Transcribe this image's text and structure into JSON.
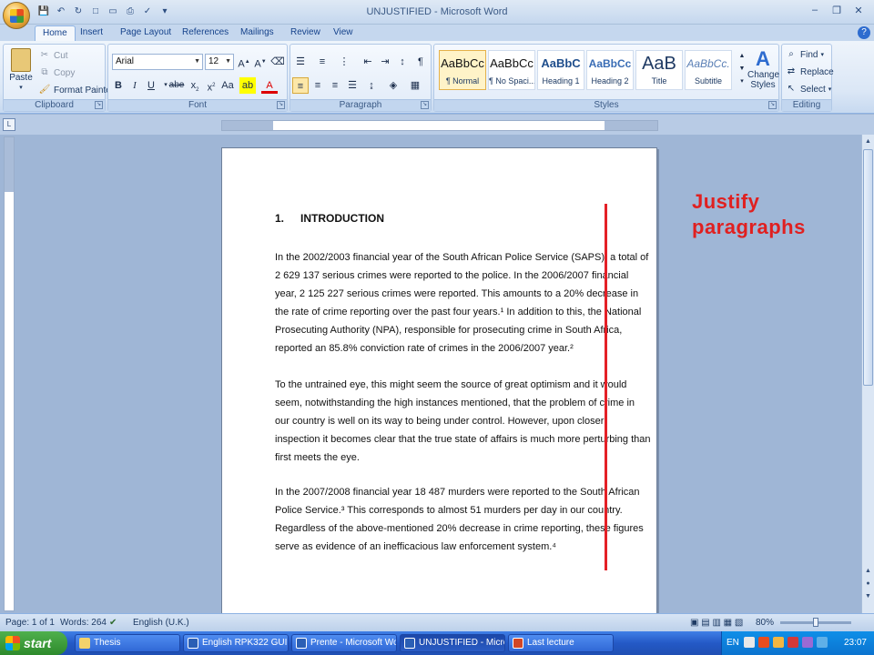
{
  "window": {
    "title": "UNJUSTIFIED - Microsoft Word"
  },
  "tabs": [
    "Home",
    "Insert",
    "Page Layout",
    "References",
    "Mailings",
    "Review",
    "View"
  ],
  "clipboard": {
    "label": "Clipboard",
    "paste": "Paste",
    "cut": "Cut",
    "copy": "Copy",
    "format_painter": "Format Painter"
  },
  "font": {
    "label": "Font",
    "name": "Arial",
    "size": "12"
  },
  "paragraph": {
    "label": "Paragraph"
  },
  "styles": {
    "label": "Styles",
    "items": [
      {
        "preview": "AaBbCc",
        "name": "¶ Normal"
      },
      {
        "preview": "AaBbCc",
        "name": "¶ No Spaci..."
      },
      {
        "preview": "AaBbC",
        "name": "Heading 1"
      },
      {
        "preview": "AaBbCc",
        "name": "Heading 2"
      },
      {
        "preview": "AaB",
        "name": "Title"
      },
      {
        "preview": "AaBbCc.",
        "name": "Subtitle"
      }
    ],
    "change_styles": "Change Styles"
  },
  "editing": {
    "label": "Editing",
    "find": "Find",
    "replace": "Replace",
    "select": "Select"
  },
  "document": {
    "heading_number": "1.",
    "heading_text": "INTRODUCTION",
    "paragraphs": [
      [
        "In the 2002/2003 financial year of the South African Police Service (SAPS), a total of",
        "2 629 137 serious crimes were reported to the police. In the 2006/2007 financial",
        "year, 2 125 227 serious crimes were reported. This amounts to a 20% decrease in",
        "the rate of crime reporting over the past four years.¹ In addition to this, the National",
        "Prosecuting Authority (NPA), responsible for prosecuting crime in South Africa,",
        "reported an 85.8% conviction rate of crimes in the 2006/2007 year.²"
      ],
      [
        "To the untrained eye, this might seem the source of great optimism and it would",
        "seem, notwithstanding the high instances mentioned, that the problem of crime in",
        "our country is well on its way to being under control. However, upon closer",
        "inspection it becomes clear that the true state of affairs is much more perturbing than",
        "first meets the eye."
      ],
      [
        "In the 2007/2008 financial year 18 487 murders were reported to the South African",
        "Police Service.³ This corresponds to almost 51 murders per day in our country.",
        "Regardless of the above-mentioned 20% decrease in crime reporting, these figures",
        "serve as evidence of an inefficacious law enforcement system.⁴"
      ]
    ]
  },
  "annotation": {
    "line1": "Justify",
    "line2": "paragraphs",
    "color": "#e02020"
  },
  "statusbar": {
    "page": "Page: 1 of 1",
    "words": "Words: 264",
    "language": "English (U.K.)",
    "zoom": "80%"
  },
  "taskbar": {
    "start": "start",
    "tasks": [
      {
        "label": "Thesis",
        "active": false
      },
      {
        "label": "English RPK322 GUID...",
        "active": false
      },
      {
        "label": "Prente - Microsoft Word",
        "active": false
      },
      {
        "label": "UNJUSTIFIED - Micro...",
        "active": true
      },
      {
        "label": "Last lecture",
        "active": false
      }
    ],
    "lang": "EN",
    "clock": "23:07"
  }
}
